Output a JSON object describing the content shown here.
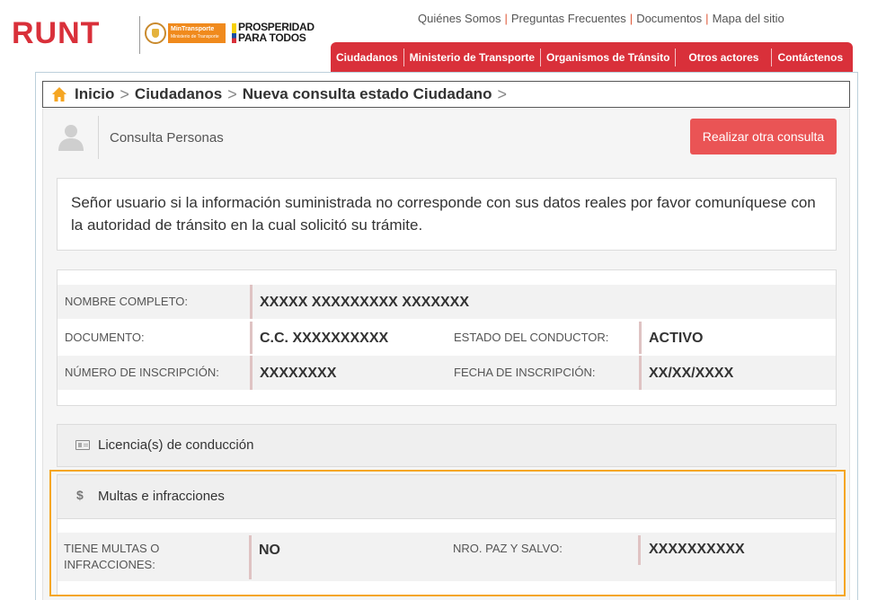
{
  "header": {
    "logo_text": "RUNT",
    "ministry_tag": "MinTransporte",
    "ministry_sub": "Ministerio de Transporte",
    "prosperidad_line1": "PROSPERIDAD",
    "prosperidad_line2": "PARA TODOS",
    "top_links": [
      "Quiénes Somos",
      "Preguntas Frecuentes",
      "Documentos",
      "Mapa del sitio"
    ],
    "nav": [
      "Ciudadanos",
      "Ministerio de Transporte",
      "Organismos de Tránsito",
      "Otros actores",
      "Contáctenos"
    ],
    "accent_color": "#d9303a"
  },
  "breadcrumb": {
    "items": [
      "Inicio",
      "Ciudadanos",
      "Nueva consulta estado Ciudadano"
    ],
    "separator": ">"
  },
  "person_bar": {
    "title": "Consulta Personas",
    "button_label": "Realizar otra consulta"
  },
  "notice": {
    "text": "Señor usuario si la información suministrada no corresponde con sus datos reales por favor comuníquese con la autoridad de tránsito en la cual solicitó su trámite."
  },
  "info": {
    "nombre_label": "NOMBRE COMPLETO:",
    "nombre_value": "XXXXX XXXXXXXXX XXXXXXX",
    "documento_label": "DOCUMENTO:",
    "documento_value": "C.C. XXXXXXXXXX",
    "estado_label": "ESTADO DEL CONDUCTOR:",
    "estado_value": "ACTIVO",
    "inscripcion_label": "NÚMERO DE INSCRIPCIÓN:",
    "inscripcion_value": "XXXXXXXX",
    "fecha_label": "FECHA DE INSCRIPCIÓN:",
    "fecha_value": "XX/XX/XXXX"
  },
  "licencias": {
    "title": "Licencia(s) de conducción"
  },
  "multas": {
    "icon_glyph": "$",
    "title": "Multas e infracciones",
    "tiene_label": "TIENE MULTAS O INFRACCIONES:",
    "tiene_value": "NO",
    "paz_label": "NRO. PAZ Y SALVO:",
    "paz_value": "XXXXXXXXXX"
  },
  "highlight_color": "#f5a623"
}
